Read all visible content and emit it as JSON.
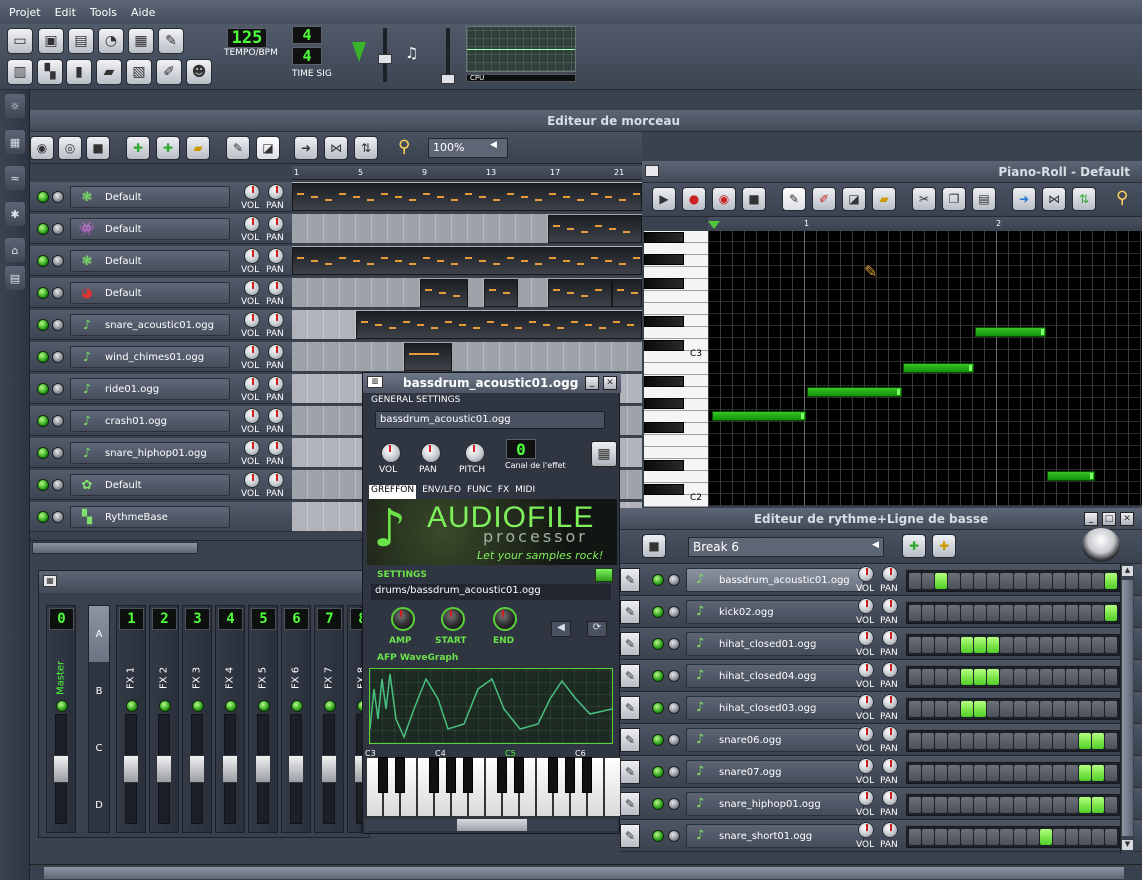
{
  "menu": [
    "Projet",
    "Edit",
    "Tools",
    "Aide"
  ],
  "toolbar": {
    "tempo": "125",
    "tempo_label": "TEMPO/BPM",
    "sig_num": "4",
    "sig_den": "4",
    "sig_label": "TIME SIG",
    "cpu_label": "CPU"
  },
  "song_editor": {
    "title": "Editeur de morceau",
    "zoom": "100%",
    "ruler": [
      "1",
      "5",
      "9",
      "13",
      "17",
      "21"
    ],
    "tracks": [
      {
        "name": "Default",
        "icon": "plugin-icon"
      },
      {
        "name": "Default",
        "icon": "alien-icon"
      },
      {
        "name": "Default",
        "icon": "plugin-icon"
      },
      {
        "name": "Default",
        "icon": "ball-icon"
      },
      {
        "name": "snare_acoustic01.ogg",
        "icon": "note-icon"
      },
      {
        "name": "wind_chimes01.ogg",
        "icon": "note-icon"
      },
      {
        "name": "ride01.ogg",
        "icon": "note-icon"
      },
      {
        "name": "crash01.ogg",
        "icon": "note-icon"
      },
      {
        "name": "snare_hiphop01.ogg",
        "icon": "note-icon"
      },
      {
        "name": "Default",
        "icon": "carrot-icon"
      },
      {
        "name": "RythmeBase",
        "icon": "beat-icon"
      }
    ],
    "vol_label": "VOL",
    "pan_label": "PAN"
  },
  "piano_roll": {
    "title": "Piano-Roll - Default",
    "ruler": [
      "1",
      "2"
    ],
    "c3": "C3",
    "c2": "C2"
  },
  "mixer": {
    "master_label": "Master",
    "master_lcd": "0",
    "channels": [
      {
        "label": "FX 1",
        "lcd": "1"
      },
      {
        "label": "FX 2",
        "lcd": "2"
      },
      {
        "label": "FX 3",
        "lcd": "3"
      },
      {
        "label": "FX 4",
        "lcd": "4"
      },
      {
        "label": "FX 5",
        "lcd": "5"
      },
      {
        "label": "FX 6",
        "lcd": "6"
      },
      {
        "label": "FX 7",
        "lcd": "7"
      },
      {
        "label": "FX 8",
        "lcd": "8"
      }
    ],
    "banks": [
      "A",
      "B",
      "C",
      "D"
    ]
  },
  "afp": {
    "title": "bassdrum_acoustic01.ogg",
    "general": "GENERAL SETTINGS",
    "name_field": "bassdrum_acoustic01.ogg",
    "vol": "VOL",
    "pan": "PAN",
    "pitch": "PITCH",
    "canal_lcd": "0",
    "canal_label": "Canal de l'effet",
    "tabs": [
      "GREFFON",
      "ENV/LFO",
      "FUNC",
      "FX",
      "MIDI"
    ],
    "logo_title": "AUDIOFILE",
    "logo_sub": "processor",
    "logo_slogan": "Let your samples rock!",
    "settings": "SETTINGS",
    "path": "drums/bassdrum_acoustic01.ogg",
    "amp": "AMP",
    "start": "START",
    "end": "END",
    "wavegraph": "AFP WaveGraph",
    "octaves": [
      "C3",
      "C4",
      "C5",
      "C6"
    ]
  },
  "beat_editor": {
    "title": "Editeur de rythme+Ligne de basse",
    "pattern": "Break 6",
    "rows": [
      {
        "name": "bassdrum_acoustic01.ogg",
        "selected": true,
        "steps": [
          0,
          0,
          1,
          0,
          0,
          0,
          0,
          0,
          0,
          0,
          0,
          0,
          0,
          0,
          0,
          1
        ]
      },
      {
        "name": "kick02.ogg",
        "selected": false,
        "steps": [
          0,
          0,
          0,
          0,
          0,
          0,
          0,
          0,
          0,
          0,
          0,
          0,
          0,
          0,
          0,
          1
        ]
      },
      {
        "name": "hihat_closed01.ogg",
        "selected": false,
        "steps": [
          0,
          0,
          0,
          0,
          1,
          1,
          1,
          0,
          0,
          0,
          0,
          0,
          0,
          0,
          0,
          0
        ]
      },
      {
        "name": "hihat_closed04.ogg",
        "selected": false,
        "steps": [
          0,
          0,
          0,
          0,
          1,
          1,
          1,
          0,
          0,
          0,
          0,
          0,
          0,
          0,
          0,
          0
        ]
      },
      {
        "name": "hihat_closed03.ogg",
        "selected": false,
        "steps": [
          0,
          0,
          0,
          0,
          1,
          1,
          0,
          0,
          0,
          0,
          0,
          0,
          0,
          0,
          0,
          0
        ]
      },
      {
        "name": "snare06.ogg",
        "selected": false,
        "steps": [
          0,
          0,
          0,
          0,
          0,
          0,
          0,
          0,
          0,
          0,
          0,
          0,
          0,
          1,
          1,
          0
        ]
      },
      {
        "name": "snare07.ogg",
        "selected": false,
        "steps": [
          0,
          0,
          0,
          0,
          0,
          0,
          0,
          0,
          0,
          0,
          0,
          0,
          0,
          1,
          1,
          0
        ]
      },
      {
        "name": "snare_hiphop01.ogg",
        "selected": false,
        "steps": [
          0,
          0,
          0,
          0,
          0,
          0,
          0,
          0,
          0,
          0,
          0,
          0,
          0,
          1,
          1,
          0
        ]
      },
      {
        "name": "snare_short01.ogg",
        "selected": false,
        "steps": [
          0,
          0,
          0,
          0,
          0,
          0,
          0,
          0,
          0,
          0,
          1,
          0,
          0,
          0,
          0,
          0
        ]
      }
    ]
  }
}
